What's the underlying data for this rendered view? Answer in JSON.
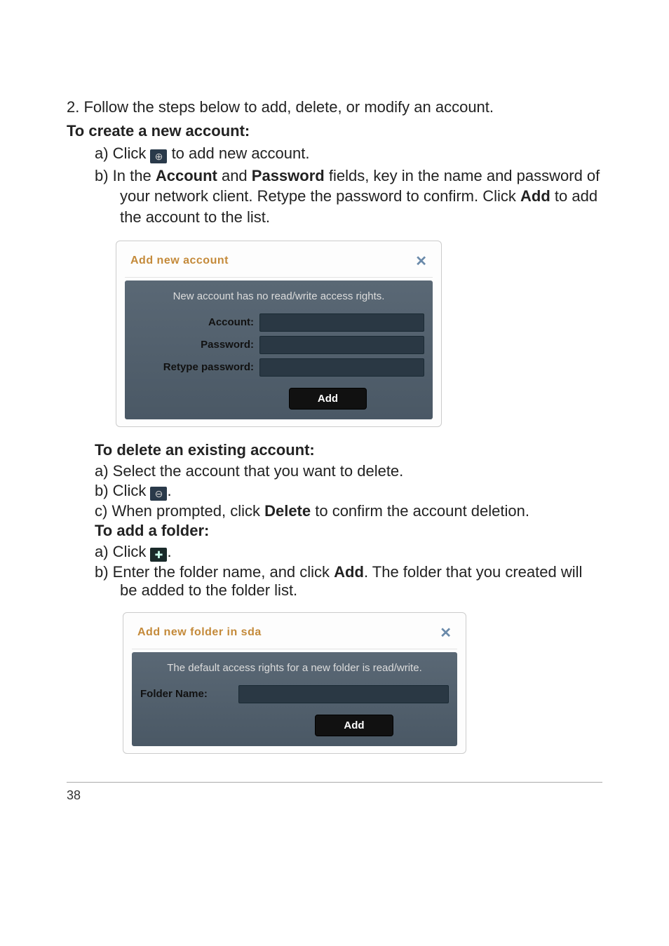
{
  "step2": "2.  Follow the steps below to add, delete, or modify an account.",
  "create": {
    "heading": "To create a new account:",
    "a_pre": "a)  Click ",
    "a_post": " to add new account.",
    "b_pre": "b)  In the ",
    "b_acct": "Account",
    "b_mid1": " and ",
    "b_pwd": "Password",
    "b_mid2": " fields, key in the name and password of your network client. Retype the password to confirm. Click ",
    "b_add": "Add",
    "b_post": " to add the account to the list."
  },
  "dlg1": {
    "title": "Add new account",
    "close": "✕",
    "msg": "New account has no read/write access rights.",
    "lbl_account": "Account:",
    "lbl_password": "Password:",
    "lbl_retype": "Retype password:",
    "btn": "Add"
  },
  "delete": {
    "heading": "To delete an existing account:",
    "a": "a)  Select the account that you want to delete.",
    "b_pre": "b)  Click ",
    "b_post": ".",
    "c_pre": "c)  When prompted, click ",
    "c_del": "Delete",
    "c_post": " to confirm the account deletion."
  },
  "folder": {
    "heading": "To add a folder:",
    "a_pre": "a)  Click ",
    "a_post": ".",
    "b_pre": "b)  Enter the folder name, and click ",
    "b_add": "Add",
    "b_post": ". The folder that you created will be added to the folder list."
  },
  "dlg2": {
    "title": "Add new folder in   sda",
    "close": "✕",
    "msg": "The default access rights for a new folder is read/write.",
    "lbl_folder": "Folder Name:",
    "btn": "Add"
  },
  "icons": {
    "plus": "⊕",
    "minus": "⊖",
    "folder_plus": "✚"
  },
  "page_number": "38"
}
